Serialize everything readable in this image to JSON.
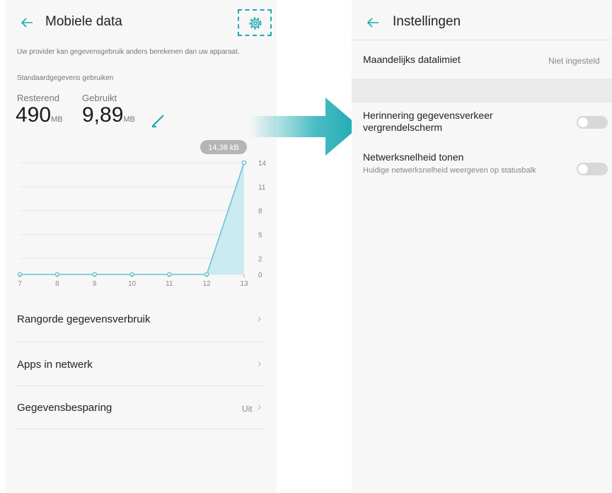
{
  "left_screen": {
    "title": "Mobiele data",
    "notice": "Uw provider kan gegevensgebruik anders berekenen dan uw apparaat.",
    "default_data_label": "Standaardgegevens gebruiken",
    "remaining_label": "Resterend",
    "remaining_value": "490",
    "remaining_unit": "MB",
    "used_label": "Gebruikt",
    "used_value": "9,89",
    "used_unit": "MB",
    "menu": [
      {
        "label": "Rangorde gegevensverbruik",
        "value": ""
      },
      {
        "label": "Apps in netwerk",
        "value": ""
      },
      {
        "label": "Gegevensbesparing",
        "value": "Uit"
      }
    ]
  },
  "right_screen": {
    "title": "Instellingen",
    "monthly_limit_label": "Maandelijks datalimiet",
    "monthly_limit_value": "Niet ingesteld",
    "reminder_label": "Herinnering gegevensverkeer vergrendelscherm",
    "reminder_toggle_on": false,
    "network_speed_label": "Netwerksnelheid tonen",
    "network_speed_sublabel": "Huidige netwerksnelheid weergeven op statusbalk",
    "network_speed_toggle_on": false
  },
  "colors": {
    "accent": "#1ca9b3",
    "line": "#5fc3d6",
    "fill": "#bfe6f0",
    "toggle_off": "#d8d8d8"
  },
  "icons": {
    "back": "arrow-left-icon",
    "settings": "gear-icon",
    "edit": "pencil-icon",
    "chevron": "chevron-right-icon",
    "flow": "arrow-right-icon"
  },
  "chart_data": {
    "type": "area",
    "x": [
      7,
      8,
      9,
      10,
      11,
      12,
      13
    ],
    "values": [
      0,
      0,
      0,
      0,
      0,
      0,
      14
    ],
    "y_ticks": [
      0,
      2,
      5,
      8,
      11,
      14
    ],
    "ylim": [
      0,
      14
    ],
    "tooltip": "14,38 kB",
    "grid": true
  }
}
